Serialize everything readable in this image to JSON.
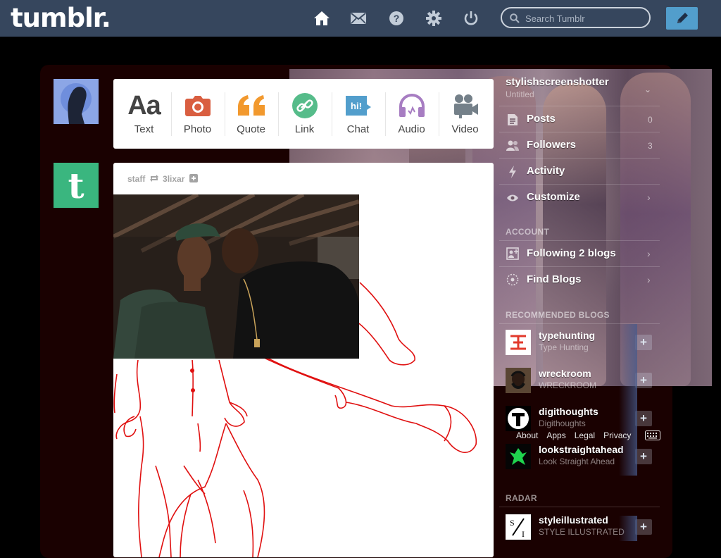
{
  "header": {
    "logo": "tumblr.",
    "search_placeholder": "Search Tumblr",
    "nav_icons": [
      "home-icon",
      "mail-icon",
      "help-icon",
      "gear-icon",
      "power-icon"
    ],
    "compose_icon": "pencil-icon",
    "colors": {
      "bar": "#36465d",
      "compose": "#529ecc"
    }
  },
  "post_types": [
    {
      "label": "Text",
      "icon": "text-icon",
      "color": "#444444"
    },
    {
      "label": "Photo",
      "icon": "camera-icon",
      "color": "#d95e40"
    },
    {
      "label": "Quote",
      "icon": "quote-icon",
      "color": "#f2992e"
    },
    {
      "label": "Link",
      "icon": "link-icon",
      "color": "#56bc8a"
    },
    {
      "label": "Chat",
      "icon": "chat-icon",
      "color": "#529ecc"
    },
    {
      "label": "Audio",
      "icon": "headphones-icon",
      "color": "#a77dc2"
    },
    {
      "label": "Video",
      "icon": "video-camera-icon",
      "color": "#748089"
    }
  ],
  "post": {
    "author": "staff",
    "reblogged_from": "3lixar",
    "reblog_icon": "reblog-icon",
    "follow_icon": "plus-icon"
  },
  "sidebar": {
    "blog_name": "stylishscreenshotter",
    "blog_title": "Untitled",
    "items": [
      {
        "label": "Posts",
        "icon": "posts-icon",
        "count": "0"
      },
      {
        "label": "Followers",
        "icon": "followers-icon",
        "count": "3"
      },
      {
        "label": "Activity",
        "icon": "lightning-icon",
        "count": ""
      },
      {
        "label": "Customize",
        "icon": "eye-icon",
        "count": ""
      }
    ],
    "account_heading": "ACCOUNT",
    "account_items": [
      {
        "label": "Following 2 blogs",
        "icon": "following-icon"
      },
      {
        "label": "Find Blogs",
        "icon": "compass-icon"
      }
    ],
    "recommended_heading": "RECOMMENDED BLOGS",
    "recommended": [
      {
        "name": "typehunting",
        "title": "Type Hunting"
      },
      {
        "name": "wreckroom",
        "title": "WRECKROOM"
      },
      {
        "name": "digithoughts",
        "title": "Digithoughts"
      },
      {
        "name": "lookstraightahead",
        "title": "Look Straight Ahead"
      }
    ],
    "radar_heading": "RADAR",
    "radar": {
      "name": "styleillustrated",
      "title": "STYLE ILLUSTRATED"
    },
    "add_label": "+"
  },
  "footer": {
    "links": [
      "About",
      "Apps",
      "Legal",
      "Privacy"
    ],
    "keyboard_icon": "keyboard-icon"
  }
}
